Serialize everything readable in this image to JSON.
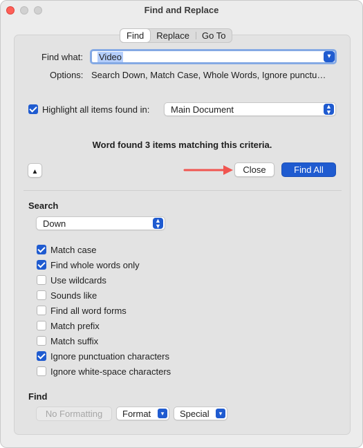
{
  "window": {
    "title": "Find and Replace"
  },
  "tabs": [
    {
      "label": "Find",
      "active": true
    },
    {
      "label": "Replace",
      "active": false
    },
    {
      "label": "Go To",
      "active": false
    }
  ],
  "find_what": {
    "label": "Find what:",
    "value": "Video"
  },
  "options": {
    "label": "Options:",
    "value": "Search Down, Match Case, Whole Words, Ignore punctu…"
  },
  "highlight": {
    "label": "Highlight all items found in:",
    "checked": true,
    "scope": "Main Document"
  },
  "status_message": "Word found 3 items matching this criteria.",
  "buttons": {
    "close": "Close",
    "find_all": "Find All",
    "collapse_icon": "chevron-up-icon"
  },
  "search": {
    "heading": "Search",
    "direction": "Down",
    "options": [
      {
        "label": "Match case",
        "checked": true
      },
      {
        "label": "Find whole words only",
        "checked": true
      },
      {
        "label": "Use wildcards",
        "checked": false
      },
      {
        "label": "Sounds like",
        "checked": false
      },
      {
        "label": "Find all word forms",
        "checked": false
      },
      {
        "label": "Match prefix",
        "checked": false
      },
      {
        "label": "Match suffix",
        "checked": false
      },
      {
        "label": "Ignore punctuation characters",
        "checked": true
      },
      {
        "label": "Ignore white-space characters",
        "checked": false
      }
    ]
  },
  "find_section": {
    "heading": "Find",
    "no_formatting": "No Formatting",
    "format": "Format",
    "special": "Special"
  },
  "colors": {
    "accent": "#1f5bd0",
    "arrow": "#f05550",
    "close_light": "#fe5f57"
  }
}
